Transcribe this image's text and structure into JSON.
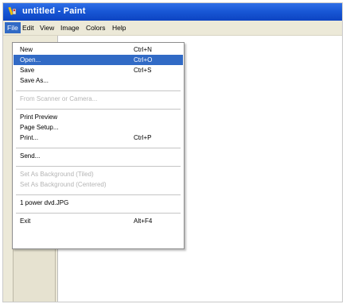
{
  "window": {
    "title": "untitled - Paint"
  },
  "menubar": [
    "File",
    "Edit",
    "View",
    "Image",
    "Colors",
    "Help"
  ],
  "file_menu": {
    "new": {
      "label": "New",
      "shortcut": "Ctrl+N"
    },
    "open": {
      "label": "Open...",
      "shortcut": "Ctrl+O"
    },
    "save": {
      "label": "Save",
      "shortcut": "Ctrl+S"
    },
    "save_as": {
      "label": "Save As..."
    },
    "from_scanner": {
      "label": "From Scanner or Camera..."
    },
    "print_preview": {
      "label": "Print Preview"
    },
    "page_setup": {
      "label": "Page Setup..."
    },
    "print": {
      "label": "Print...",
      "shortcut": "Ctrl+P"
    },
    "send": {
      "label": "Send..."
    },
    "set_bg_tiled": {
      "label": "Set As Background (Tiled)"
    },
    "set_bg_centered": {
      "label": "Set As Background (Centered)"
    },
    "recent_file": {
      "label": "1 power dvd.JPG"
    },
    "exit": {
      "label": "Exit",
      "shortcut": "Alt+F4"
    }
  },
  "colors": {
    "titlebar": "#1958d6",
    "highlight": "#316ac5",
    "menubar": "#ece9d8"
  },
  "icons": {
    "app": "paint-app-icon"
  }
}
